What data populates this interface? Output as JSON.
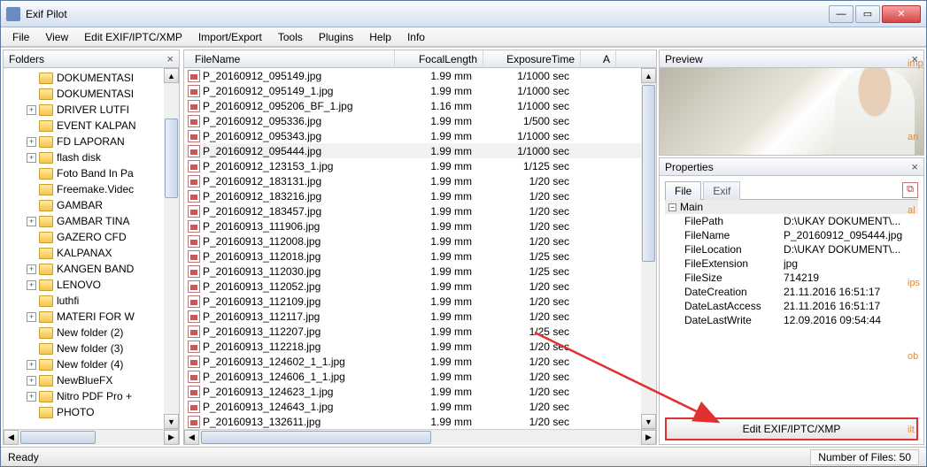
{
  "window": {
    "title": "Exif Pilot"
  },
  "menu": [
    "File",
    "View",
    "Edit EXIF/IPTC/XMP",
    "Import/Export",
    "Tools",
    "Plugins",
    "Help",
    "Info"
  ],
  "folders": {
    "title": "Folders",
    "items": [
      {
        "exp": null,
        "label": "DOKUMENTASI"
      },
      {
        "exp": null,
        "label": "DOKUMENTASI"
      },
      {
        "exp": "+",
        "label": "DRIVER LUTFI"
      },
      {
        "exp": null,
        "label": "EVENT KALPAN"
      },
      {
        "exp": "+",
        "label": "FD LAPORAN"
      },
      {
        "exp": "+",
        "label": "flash disk"
      },
      {
        "exp": null,
        "label": "Foto Band In Pa"
      },
      {
        "exp": null,
        "label": "Freemake.Videc"
      },
      {
        "exp": null,
        "label": "GAMBAR"
      },
      {
        "exp": "+",
        "label": "GAMBAR TINA"
      },
      {
        "exp": null,
        "label": "GAZERO CFD"
      },
      {
        "exp": null,
        "label": "KALPANAX"
      },
      {
        "exp": "+",
        "label": "KANGEN BAND"
      },
      {
        "exp": "+",
        "label": "LENOVO"
      },
      {
        "exp": null,
        "label": "luthfi"
      },
      {
        "exp": "+",
        "label": "MATERI FOR W"
      },
      {
        "exp": null,
        "label": "New folder (2)"
      },
      {
        "exp": null,
        "label": "New folder (3)"
      },
      {
        "exp": "+",
        "label": "New folder (4)"
      },
      {
        "exp": "+",
        "label": "NewBlueFX"
      },
      {
        "exp": "+",
        "label": "Nitro PDF Pro +"
      },
      {
        "exp": null,
        "label": "PHOTO"
      }
    ]
  },
  "files": {
    "columns": {
      "name": "FileName",
      "focal": "FocalLength",
      "exp": "ExposureTime",
      "a": "A"
    },
    "rows": [
      {
        "name": "P_20160912_095149.jpg",
        "focal": "1.99 mm",
        "exp": "1/1000 sec",
        "sel": false
      },
      {
        "name": "P_20160912_095149_1.jpg",
        "focal": "1.99 mm",
        "exp": "1/1000 sec",
        "sel": false
      },
      {
        "name": "P_20160912_095206_BF_1.jpg",
        "focal": "1.16 mm",
        "exp": "1/1000 sec",
        "sel": false
      },
      {
        "name": "P_20160912_095336.jpg",
        "focal": "1.99 mm",
        "exp": "1/500 sec",
        "sel": false
      },
      {
        "name": "P_20160912_095343.jpg",
        "focal": "1.99 mm",
        "exp": "1/1000 sec",
        "sel": false
      },
      {
        "name": "P_20160912_095444.jpg",
        "focal": "1.99 mm",
        "exp": "1/1000 sec",
        "sel": true
      },
      {
        "name": "P_20160912_123153_1.jpg",
        "focal": "1.99 mm",
        "exp": "1/125 sec",
        "sel": false
      },
      {
        "name": "P_20160912_183131.jpg",
        "focal": "1.99 mm",
        "exp": "1/20 sec",
        "sel": false
      },
      {
        "name": "P_20160912_183216.jpg",
        "focal": "1.99 mm",
        "exp": "1/20 sec",
        "sel": false
      },
      {
        "name": "P_20160912_183457.jpg",
        "focal": "1.99 mm",
        "exp": "1/20 sec",
        "sel": false
      },
      {
        "name": "P_20160913_111906.jpg",
        "focal": "1.99 mm",
        "exp": "1/20 sec",
        "sel": false
      },
      {
        "name": "P_20160913_112008.jpg",
        "focal": "1.99 mm",
        "exp": "1/20 sec",
        "sel": false
      },
      {
        "name": "P_20160913_112018.jpg",
        "focal": "1.99 mm",
        "exp": "1/25 sec",
        "sel": false
      },
      {
        "name": "P_20160913_112030.jpg",
        "focal": "1.99 mm",
        "exp": "1/25 sec",
        "sel": false
      },
      {
        "name": "P_20160913_112052.jpg",
        "focal": "1.99 mm",
        "exp": "1/20 sec",
        "sel": false
      },
      {
        "name": "P_20160913_112109.jpg",
        "focal": "1.99 mm",
        "exp": "1/20 sec",
        "sel": false
      },
      {
        "name": "P_20160913_112117.jpg",
        "focal": "1.99 mm",
        "exp": "1/20 sec",
        "sel": false
      },
      {
        "name": "P_20160913_112207.jpg",
        "focal": "1.99 mm",
        "exp": "1/25 sec",
        "sel": false
      },
      {
        "name": "P_20160913_112218.jpg",
        "focal": "1.99 mm",
        "exp": "1/20 sec",
        "sel": false
      },
      {
        "name": "P_20160913_124602_1_1.jpg",
        "focal": "1.99 mm",
        "exp": "1/20 sec",
        "sel": false
      },
      {
        "name": "P_20160913_124606_1_1.jpg",
        "focal": "1.99 mm",
        "exp": "1/20 sec",
        "sel": false
      },
      {
        "name": "P_20160913_124623_1.jpg",
        "focal": "1.99 mm",
        "exp": "1/20 sec",
        "sel": false
      },
      {
        "name": "P_20160913_124643_1.jpg",
        "focal": "1.99 mm",
        "exp": "1/20 sec",
        "sel": false
      },
      {
        "name": "P_20160913_132611.jpg",
        "focal": "1.99 mm",
        "exp": "1/20 sec",
        "sel": false
      }
    ]
  },
  "preview": {
    "title": "Preview"
  },
  "properties": {
    "title": "Properties",
    "tabs": {
      "file": "File",
      "exif": "Exif"
    },
    "group": "Main",
    "rows": [
      {
        "k": "FilePath",
        "v": "D:\\UKAY DOKUMENT\\..."
      },
      {
        "k": "FileName",
        "v": "P_20160912_095444.jpg"
      },
      {
        "k": "FileLocation",
        "v": "D:\\UKAY DOKUMENT\\..."
      },
      {
        "k": "FileExtension",
        "v": "jpg"
      },
      {
        "k": "FileSize",
        "v": "714219"
      },
      {
        "k": "DateCreation",
        "v": "21.11.2016 16:51:17"
      },
      {
        "k": "DateLastAccess",
        "v": "21.11.2016 16:51:17"
      },
      {
        "k": "DateLastWrite",
        "v": "12.09.2016 09:54:44"
      }
    ],
    "editButton": "Edit EXIF/IPTC/XMP"
  },
  "status": {
    "ready": "Ready",
    "count": "Number of Files: 50"
  },
  "sideNotes": [
    "imp",
    "an",
    "al",
    "ips",
    "ob",
    "ilt"
  ]
}
